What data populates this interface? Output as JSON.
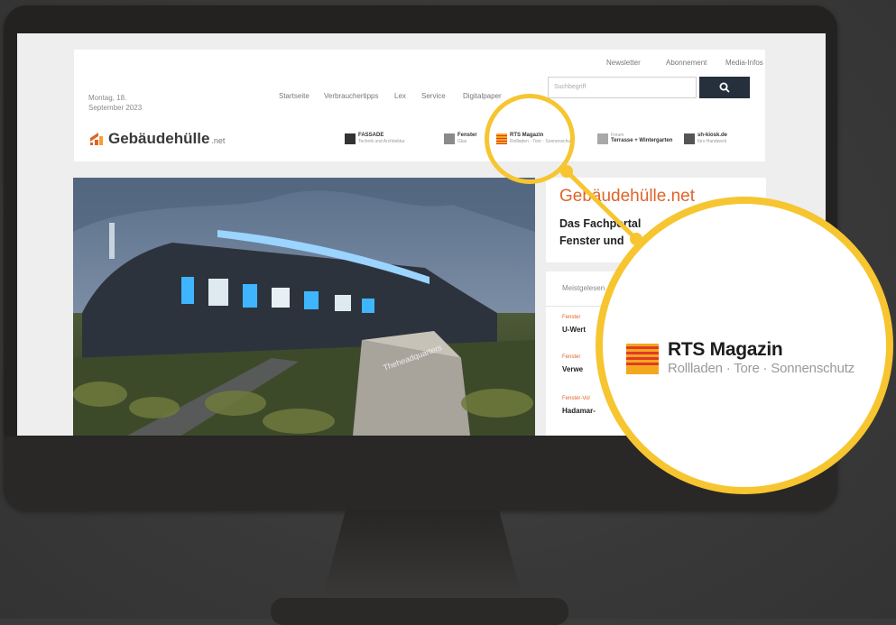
{
  "header": {
    "date_line1": "Montag, 18.",
    "date_line2": "September 2023",
    "nav": [
      "Startseite",
      "Verbrauchertipps",
      "Lex",
      "Service",
      "Digitalpaper"
    ],
    "top_links": [
      "Newsletter",
      "Abonnement",
      "Media-Infos"
    ],
    "search_placeholder": "Suchbegriff",
    "logo_text": "Gebäudehülle",
    "logo_suffix": ".net"
  },
  "partners": [
    {
      "title": "FASSADE",
      "subtitle": "Technik und Architektur",
      "color": "#333333"
    },
    {
      "title": "Fenster",
      "subtitle": "Glas",
      "color": "#8a8a8a"
    },
    {
      "title": "RTS Magazin",
      "subtitle": "Rollladen · Tore · Sonnenschutz",
      "color": "#f29a1a"
    },
    {
      "title": "Terrasse + Wintergarten",
      "subtitle": "Forum",
      "color": "#a8a8a8"
    },
    {
      "title": "sh-kiosk.de",
      "subtitle": "fürs Handwerk",
      "color": "#555555"
    }
  ],
  "sidebar": {
    "brand": "Gebäudehülle.net",
    "slogan_line1": "Das Fachportal",
    "slogan_line2": "Fenster und",
    "tab_label": "Meistgelesen",
    "items": [
      {
        "category": "Fenster",
        "title": "U-Wert"
      },
      {
        "category": "Fenster",
        "title": "Verwe"
      },
      {
        "category": "Fenster-Vol",
        "title": "Hadamar-"
      }
    ]
  },
  "hero": {
    "sign_text": "Theheadquarters"
  },
  "zoom": {
    "title": "RTS Magazin",
    "subtitle": "Rollladen · Tore · Sonnenschutz"
  },
  "colors": {
    "accent": "#f6c530",
    "brand_orange": "#e0642a",
    "search_button": "#26303d"
  },
  "icons": {
    "search": "search-icon",
    "logo": "house-logo-icon"
  }
}
